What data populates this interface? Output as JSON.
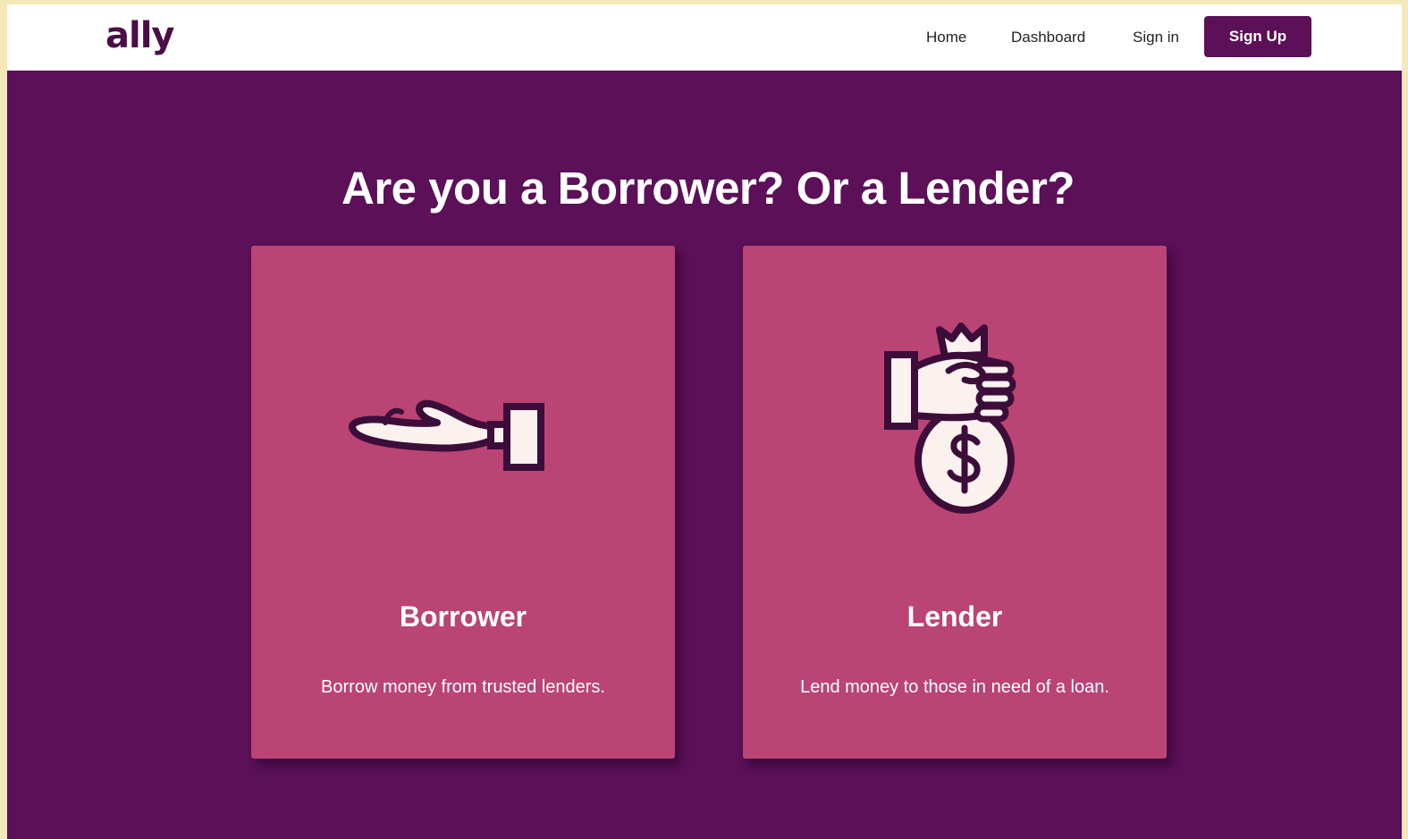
{
  "navbar": {
    "logo": "ally",
    "links": [
      "Home",
      "Dashboard",
      "Sign in"
    ],
    "signup_label": "Sign Up"
  },
  "main": {
    "heading": "Are you a Borrower? Or a Lender?",
    "cards": [
      {
        "title": "Borrower",
        "description": "Borrow money from trusted lenders.",
        "icon": "open-hand-icon"
      },
      {
        "title": "Lender",
        "description": "Lend money to those in need of a loan.",
        "icon": "hand-money-bag-icon"
      }
    ]
  },
  "colors": {
    "brand_purple": "#5b1057",
    "card_pink": "#ba4474",
    "icon_fill": "#fbf1ee",
    "icon_outline": "#3d0d3a"
  }
}
